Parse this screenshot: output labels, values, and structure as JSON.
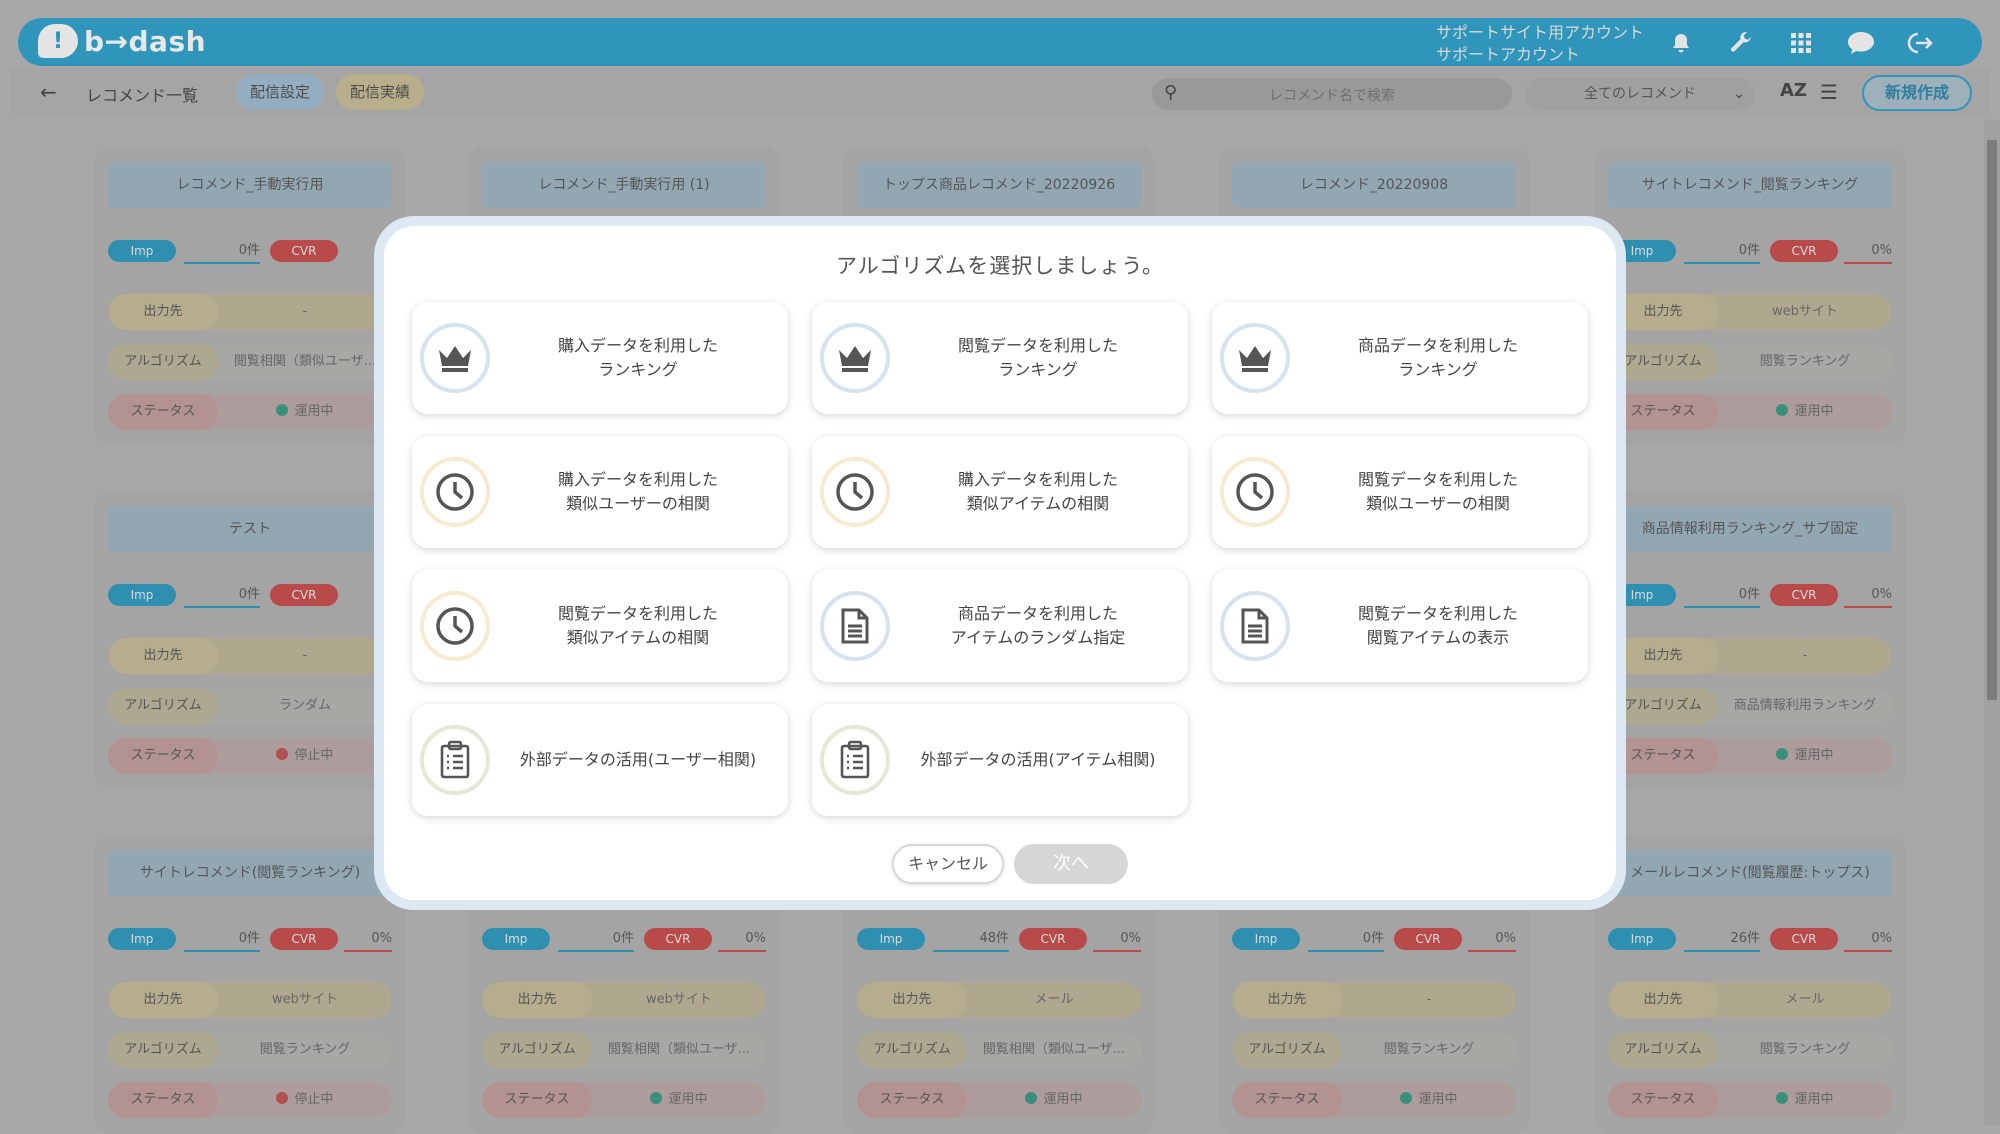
{
  "header": {
    "logo_text": "b→dash",
    "account_line1": "サポートサイト用アカウント",
    "account_line2": "サポートアカウント"
  },
  "subbar": {
    "title": "レコメンド一覧",
    "tabs": [
      {
        "label": "配信設定",
        "active": true
      },
      {
        "label": "配信実績",
        "active": false
      }
    ],
    "search_placeholder": "レコメンド名で検索",
    "filter_value": "全てのレコメンド",
    "sort_label": "AZ",
    "new_button": "新規作成"
  },
  "cards": [
    {
      "title": "レコメンド_手動実行用",
      "imp": "0件",
      "cvr": "",
      "output": "-",
      "algorithm": "閲覧相関（類似ユーザ...",
      "status": "運用中",
      "running": true
    },
    {
      "title": "レコメンド_手動実行用 (1)"
    },
    {
      "title": "トップス商品レコメンド_20220926"
    },
    {
      "title": "レコメンド_20220908"
    },
    {
      "title": "サイトレコメンド_閲覧ランキング",
      "imp": "0件",
      "cvr": "0%",
      "output": "webサイト",
      "algorithm": "閲覧ランキング",
      "status": "運用中",
      "running": true
    },
    {
      "title": "テスト",
      "imp": "0件",
      "cvr": "",
      "output": "-",
      "algorithm": "ランダム",
      "status": "停止中",
      "running": false
    },
    {
      "title": "商品情報利用ランキング_サブ固定",
      "imp": "0件",
      "cvr": "0%",
      "output": "-",
      "algorithm": "商品情報利用ランキング",
      "status": "運用中",
      "running": true
    },
    {
      "title": "サイトレコメンド(閲覧ランキング)",
      "imp": "0件",
      "cvr": "0%",
      "output": "webサイト",
      "algorithm": "閲覧ランキング",
      "status": "停止中",
      "running": false
    },
    {
      "title": "",
      "imp": "0件",
      "cvr": "0%",
      "output": "webサイト",
      "algorithm": "閲覧相関（類似ユーザ...",
      "status": "運用中",
      "running": true
    },
    {
      "title": "",
      "imp": "48件",
      "cvr": "0%",
      "output": "メール",
      "algorithm": "閲覧相関（類似ユーザ...",
      "status": "運用中",
      "running": true
    },
    {
      "title": "",
      "imp": "0件",
      "cvr": "0%",
      "output": "-",
      "algorithm": "閲覧ランキング",
      "status": "運用中",
      "running": true
    },
    {
      "title": "メールレコメンド(閲覧履歴:トップス)",
      "imp": "26件",
      "cvr": "0%",
      "output": "メール",
      "algorithm": "閲覧ランキング",
      "status": "運用中",
      "running": true
    }
  ],
  "card_labels": {
    "imp": "Imp",
    "cvr": "CVR",
    "output": "出力先",
    "algorithm": "アルゴリズム",
    "status": "ステータス"
  },
  "modal": {
    "title": "アルゴリズムを選択しましょう。",
    "options": [
      {
        "label": "購入データを利用した\nランキング",
        "icon": "crown-icon"
      },
      {
        "label": "閲覧データを利用した\nランキング",
        "icon": "crown-icon"
      },
      {
        "label": "商品データを利用した\nランキング",
        "icon": "crown-icon"
      },
      {
        "label": "購入データを利用した\n類似ユーザーの相関",
        "icon": "clock-icon"
      },
      {
        "label": "購入データを利用した\n類似アイテムの相関",
        "icon": "clock-icon"
      },
      {
        "label": "閲覧データを利用した\n類似ユーザーの相関",
        "icon": "clock-icon"
      },
      {
        "label": "閲覧データを利用した\n類似アイテムの相関",
        "icon": "clock-icon"
      },
      {
        "label": "商品データを利用した\nアイテムのランダム指定",
        "icon": "document-icon"
      },
      {
        "label": "閲覧データを利用した\n閲覧アイテムの表示",
        "icon": "document-icon"
      },
      {
        "label": "外部データの活用(ユーザー相関)",
        "icon": "clipboard-icon"
      },
      {
        "label": "外部データの活用(アイテム相関)",
        "icon": "clipboard-icon"
      }
    ],
    "cancel_label": "キャンセル",
    "next_label": "次へ"
  }
}
